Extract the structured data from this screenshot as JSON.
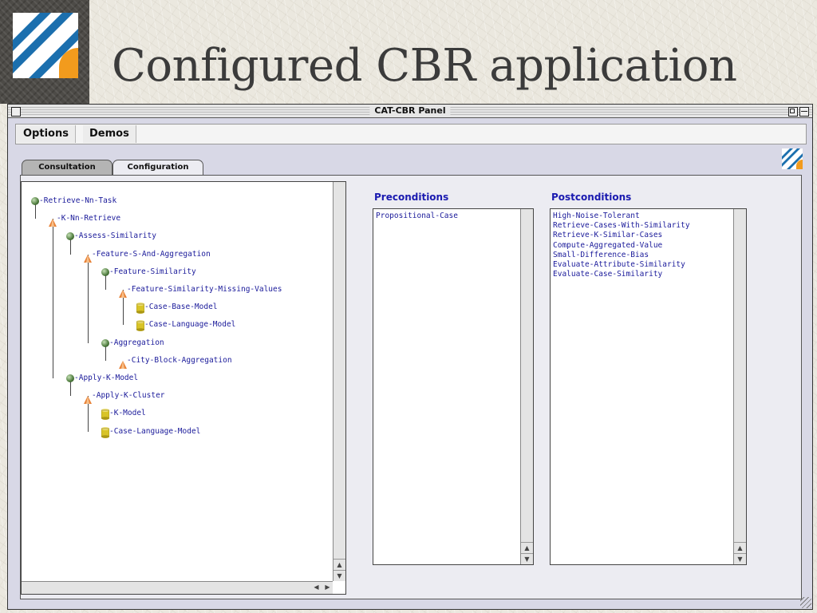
{
  "slide": {
    "title": "Configured CBR application",
    "logo_icon": "cbr-logo-stripes",
    "colors": {
      "logo_blue": "#1b6fae",
      "logo_orange": "#f29b1d",
      "background": "#ebe8df",
      "side_strip": "#4d4b47"
    }
  },
  "window": {
    "title": "CAT-CBR Panel",
    "close_icon": "close-box-icon",
    "zoom_icon": "zoom-box-icon",
    "collapse_icon": "collapse-box-icon"
  },
  "menu": {
    "items": [
      {
        "label": "Options"
      },
      {
        "label": "Demos"
      }
    ]
  },
  "tabs": {
    "items": [
      {
        "label": "Consultation",
        "selected": false
      },
      {
        "label": "Configuration",
        "selected": true
      }
    ]
  },
  "tree": {
    "nodes": [
      {
        "label": "Retrieve-Nn-Task",
        "icon": "task-ball-icon"
      },
      {
        "label": "K-Nn-Retrieve",
        "icon": "method-cone-icon"
      },
      {
        "label": "Assess-Similarity",
        "icon": "task-ball-icon"
      },
      {
        "label": "Feature-S-And-Aggregation",
        "icon": "method-cone-icon"
      },
      {
        "label": "Feature-Similarity",
        "icon": "task-ball-icon"
      },
      {
        "label": "Feature-Similarity-Missing-Values",
        "icon": "method-cone-icon"
      },
      {
        "label": "Case-Base-Model",
        "icon": "model-cylinder-icon"
      },
      {
        "label": "Case-Language-Model",
        "icon": "model-cylinder-icon"
      },
      {
        "label": "Aggregation",
        "icon": "task-ball-icon"
      },
      {
        "label": "City-Block-Aggregation",
        "icon": "method-cone-icon"
      },
      {
        "label": "Apply-K-Model",
        "icon": "task-ball-icon"
      },
      {
        "label": "Apply-K-Cluster",
        "icon": "method-cone-icon"
      },
      {
        "label": "K-Model",
        "icon": "model-cylinder-icon"
      },
      {
        "label": "Case-Language-Model",
        "icon": "model-cylinder-icon"
      }
    ]
  },
  "preconditions": {
    "title": "Preconditions",
    "items": [
      "Propositional-Case"
    ]
  },
  "postconditions": {
    "title": "Postconditions",
    "items": [
      "High-Noise-Tolerant",
      "Retrieve-Cases-With-Similarity",
      "Retrieve-K-Similar-Cases",
      "Compute-Aggregated-Value",
      "Small-Difference-Bias",
      "Evaluate-Attribute-Similarity",
      "Evaluate-Case-Similarity"
    ]
  }
}
